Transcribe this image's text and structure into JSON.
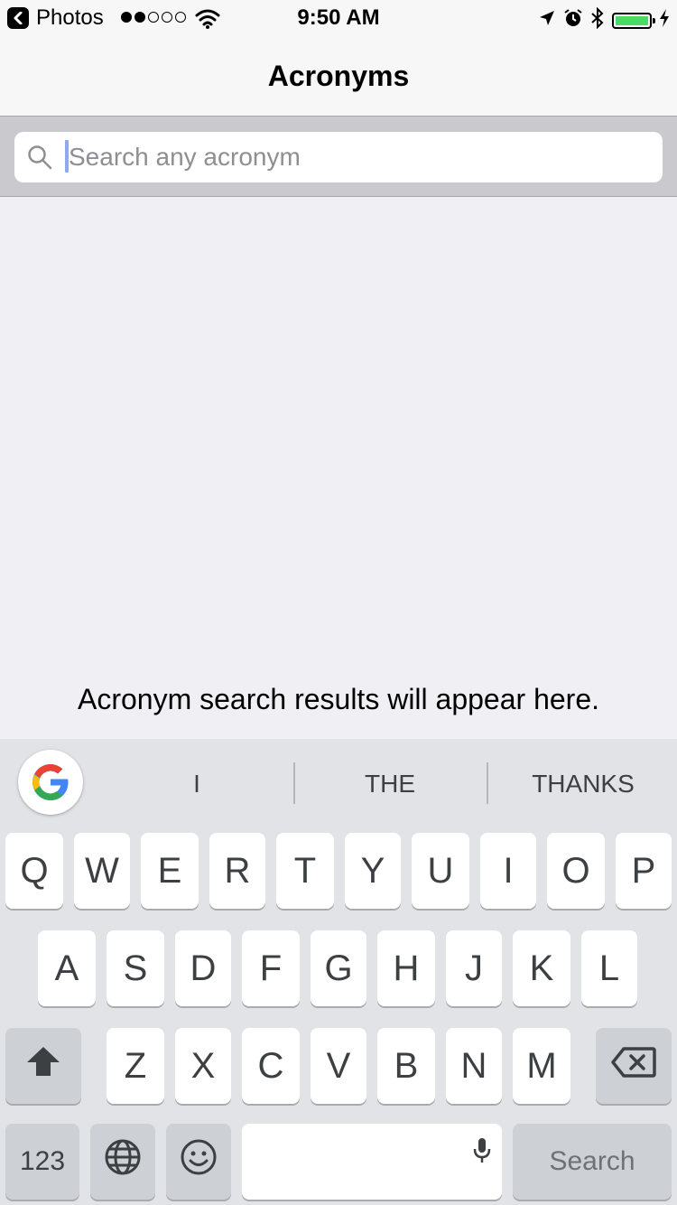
{
  "status_bar": {
    "back_app": "Photos",
    "time": "9:50 AM",
    "signal_bars": [
      1,
      1,
      0,
      0,
      0
    ],
    "battery_level": 1.0,
    "icons": [
      "back-arrow-icon",
      "wifi-icon",
      "location-icon",
      "alarm-icon",
      "bluetooth-icon",
      "battery-icon",
      "charging-icon"
    ]
  },
  "nav": {
    "title": "Acronyms"
  },
  "search": {
    "placeholder": "Search any acronym",
    "value": ""
  },
  "content": {
    "empty_message": "Acronym search results will appear here."
  },
  "keyboard": {
    "suggestions": [
      "I",
      "THE",
      "THANKS"
    ],
    "row1": [
      "Q",
      "W",
      "E",
      "R",
      "T",
      "Y",
      "U",
      "I",
      "O",
      "P"
    ],
    "row2": [
      "A",
      "S",
      "D",
      "F",
      "G",
      "H",
      "J",
      "K",
      "L"
    ],
    "row3": [
      "Z",
      "X",
      "C",
      "V",
      "B",
      "N",
      "M"
    ],
    "numbers_label": "123",
    "search_label": "Search"
  },
  "colors": {
    "battery_fill": "#4cd964",
    "search_bar_bg": "#c9c9ce",
    "content_bg": "#efeff4",
    "keyboard_bg": "#e1e3e6"
  }
}
